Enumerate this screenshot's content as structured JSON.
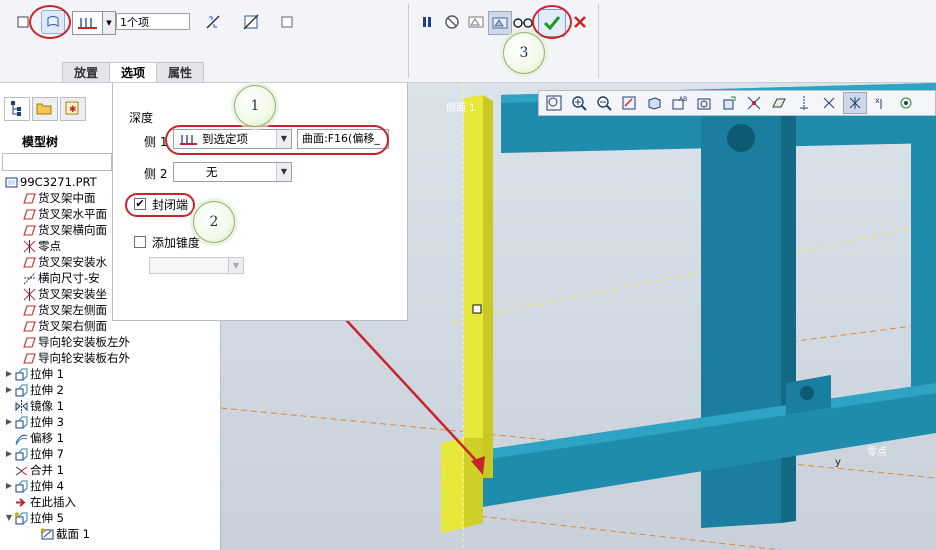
{
  "ribbon": {
    "items_count": "1个项",
    "tabs": [
      "放置",
      "选项",
      "属性"
    ],
    "active_tab": "选项"
  },
  "left": {
    "tree_label": "模型树",
    "tree": [
      {
        "label": "99C3271.PRT",
        "icon": "part-icon",
        "indent": 0,
        "exp": ""
      },
      {
        "label": "货叉架中面",
        "icon": "datum-plane-icon",
        "indent": 1,
        "exp": ""
      },
      {
        "label": "货叉架水平面",
        "icon": "datum-plane-icon",
        "indent": 1,
        "exp": ""
      },
      {
        "label": "货叉架横向面",
        "icon": "datum-plane-icon",
        "indent": 1,
        "exp": ""
      },
      {
        "label": "零点",
        "icon": "csys-icon",
        "indent": 1,
        "exp": ""
      },
      {
        "label": "货叉架安装水",
        "icon": "datum-plane-icon",
        "indent": 1,
        "exp": ""
      },
      {
        "label": "横向尺寸-安",
        "icon": "datum-axis-icon",
        "indent": 1,
        "exp": ""
      },
      {
        "label": "货叉架安装坐",
        "icon": "csys-icon",
        "indent": 1,
        "exp": ""
      },
      {
        "label": "货叉架左侧面",
        "icon": "datum-plane-icon",
        "indent": 1,
        "exp": ""
      },
      {
        "label": "货叉架右侧面",
        "icon": "datum-plane-icon",
        "indent": 1,
        "exp": ""
      },
      {
        "label": "导向轮安装板左外",
        "icon": "datum-plane-icon",
        "indent": 1,
        "exp": ""
      },
      {
        "label": "导向轮安装板右外",
        "icon": "datum-plane-icon",
        "indent": 1,
        "exp": ""
      },
      {
        "label": "拉伸 1",
        "icon": "extrude-icon",
        "indent": 0,
        "exp": "▶"
      },
      {
        "label": "拉伸 2",
        "icon": "extrude-icon",
        "indent": 0,
        "exp": "▶"
      },
      {
        "label": "镜像 1",
        "icon": "mirror-icon",
        "indent": 0,
        "exp": ""
      },
      {
        "label": "拉伸 3",
        "icon": "extrude-icon",
        "indent": 0,
        "exp": "▶"
      },
      {
        "label": "偏移 1",
        "icon": "offset-icon",
        "indent": 0,
        "exp": ""
      },
      {
        "label": "拉伸 7",
        "icon": "extrude-icon",
        "indent": 0,
        "exp": "▶"
      },
      {
        "label": "合并 1",
        "icon": "merge-icon",
        "indent": 0,
        "exp": ""
      },
      {
        "label": "拉伸 4",
        "icon": "extrude-icon",
        "indent": 0,
        "exp": "▶"
      },
      {
        "label": "在此插入",
        "icon": "insert-here-icon",
        "indent": 0,
        "exp": ""
      },
      {
        "label": "拉伸 5",
        "icon": "extrude-active-icon",
        "indent": 0,
        "exp": "▼"
      },
      {
        "label": "截面 1",
        "icon": "section-icon",
        "indent": 2,
        "exp": ""
      }
    ]
  },
  "options": {
    "depth_label": "深度",
    "side1_label": "侧 1",
    "side1_value": "到选定项",
    "side1_ref": "曲面:F16(偏移_",
    "side2_label": "侧 2",
    "side2_value": "无",
    "capped_label": "封闭端",
    "capped_checked": true,
    "draft_label": "添加锥度",
    "draft_checked": false
  },
  "callouts": [
    "1",
    "2",
    "3"
  ],
  "viewport": {
    "labels": [
      "侧面 1",
      "零点",
      "y"
    ]
  },
  "colors": {
    "accent_red": "#c8242a",
    "model_blue": "#1e8fb0",
    "highlight_yellow": "#e8e83a"
  }
}
